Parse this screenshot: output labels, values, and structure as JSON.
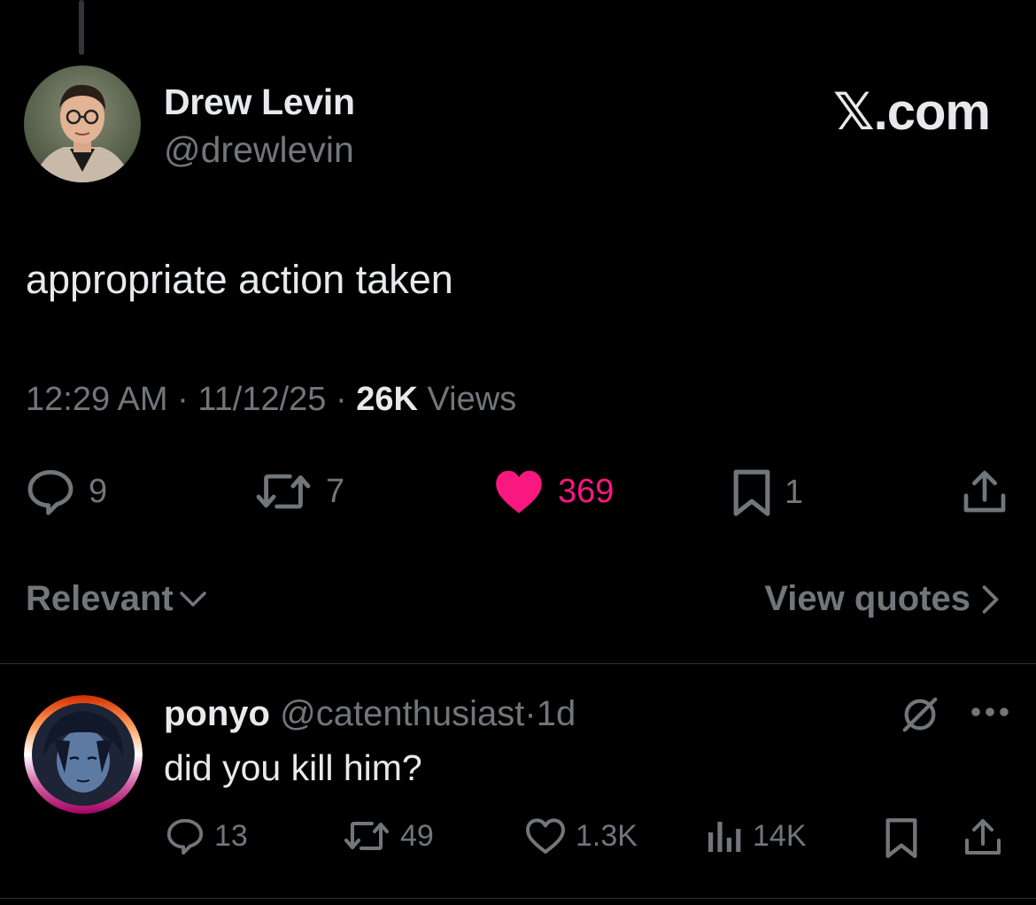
{
  "brand": {
    "logo_letter": "𝕏",
    "logo_suffix": ".com"
  },
  "tweet": {
    "author_name": "Drew Levin",
    "author_handle": "@drewlevin",
    "text": "appropriate action taken",
    "time": "12:29 AM",
    "date": "11/12/25",
    "views_count": "26K",
    "views_label": "Views",
    "separator": "·",
    "actions": {
      "replies": "9",
      "reposts": "7",
      "likes": "369",
      "bookmarks": "1"
    }
  },
  "replies_bar": {
    "sort_label": "Relevant",
    "quotes_label": "View quotes"
  },
  "reply": {
    "author_name": "ponyo",
    "author_handle": "@catenthusiast",
    "time": "1d",
    "separator": "·",
    "text": "did you kill him?",
    "actions": {
      "replies": "13",
      "reposts": "49",
      "likes": "1.3K",
      "views": "14K"
    }
  },
  "icons": {
    "reply": "speech-bubble-icon",
    "repost": "repost-arrows-icon",
    "like": "heart-icon",
    "bookmark": "bookmark-icon",
    "share": "share-upload-icon",
    "views": "bar-chart-icon",
    "grok": "grok-slash-icon",
    "more": "more-dots-icon",
    "chevron_down": "chevron-down-icon",
    "chevron_right": "chevron-right-icon"
  },
  "colors": {
    "background": "#000000",
    "text_primary": "#e7e9ea",
    "text_secondary": "#71767b",
    "like_active": "#f91880",
    "divider": "#2f3336"
  }
}
